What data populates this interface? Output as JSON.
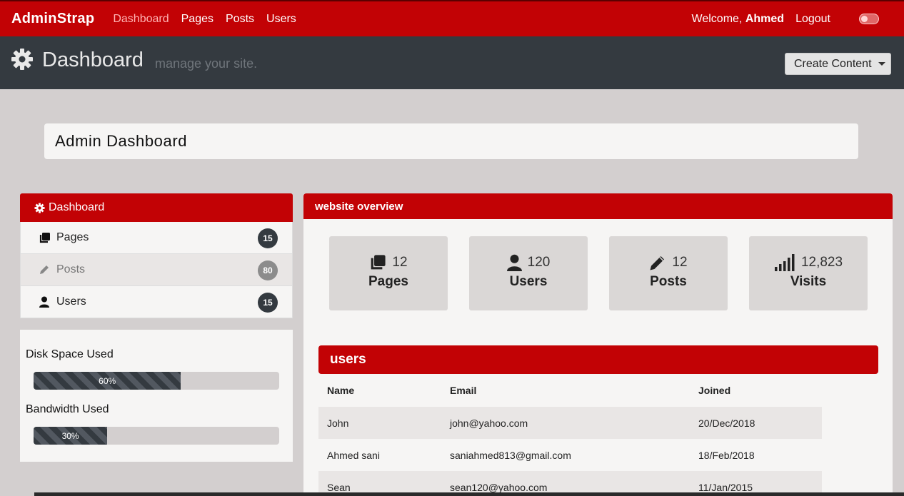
{
  "navbar": {
    "brand": "AdminStrap",
    "links": [
      "Dashboard",
      "Pages",
      "Posts",
      "Users"
    ],
    "welcome_prefix": "Welcome,",
    "welcome_user": "Ahmed",
    "logout": "Logout"
  },
  "header": {
    "title": "Dashboard",
    "subtitle": "manage your site.",
    "create_button": "Create Content"
  },
  "breadcrumb": {
    "text": "Admin Dashboard"
  },
  "sidebar": {
    "header": "Dashboard",
    "items": [
      {
        "label": "Pages",
        "count": "15",
        "icon": "pages-icon"
      },
      {
        "label": "Posts",
        "count": "80",
        "icon": "pencil-icon"
      },
      {
        "label": "Users",
        "count": "15",
        "icon": "user-icon"
      }
    ]
  },
  "usage": {
    "disk_label": "Disk Space Used",
    "disk_value": "60%",
    "disk_percent": 60,
    "bandwidth_label": "Bandwidth Used",
    "bandwidth_value": "30%",
    "bandwidth_percent": 30
  },
  "overview": {
    "title": "website overview",
    "stats": [
      {
        "value": "12",
        "label": "Pages",
        "icon": "pages-icon"
      },
      {
        "value": "120",
        "label": "Users",
        "icon": "user-icon"
      },
      {
        "value": "12",
        "label": "Posts",
        "icon": "pencil-icon"
      },
      {
        "value": "12,823",
        "label": "Visits",
        "icon": "signal-icon"
      }
    ]
  },
  "users_table": {
    "title": "users",
    "columns": [
      "Name",
      "Email",
      "Joined"
    ],
    "rows": [
      {
        "name": "John",
        "email": "john@yahoo.com",
        "joined": "20/Dec/2018"
      },
      {
        "name": "Ahmed sani",
        "email": "saniahmed813@gmail.com",
        "joined": "18/Feb/2018"
      },
      {
        "name": "Sean",
        "email": "sean120@yahoo.com",
        "joined": "11/Jan/2015"
      }
    ]
  },
  "colors": {
    "brand_red": "#c20205",
    "dark": "#343a40",
    "page_bg": "#d3cfcf"
  }
}
